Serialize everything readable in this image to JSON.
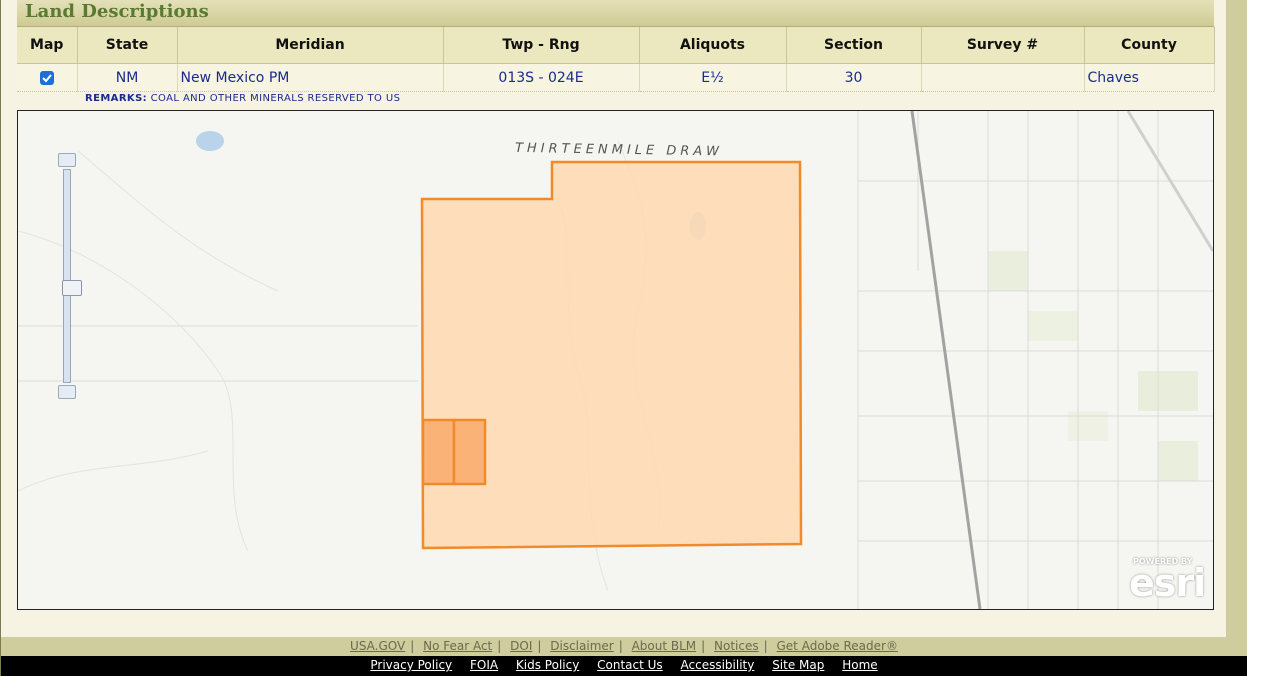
{
  "section": {
    "title": "Land Descriptions"
  },
  "table": {
    "headers": [
      "Map",
      "State",
      "Meridian",
      "Twp - Rng",
      "Aliquots",
      "Section",
      "Survey #",
      "County"
    ],
    "row": {
      "map_checked": true,
      "state": "NM",
      "meridian": "New Mexico PM",
      "twp_rng": "013S - 024E",
      "aliquots": "E½",
      "section": "30",
      "survey": "",
      "county": "Chaves"
    },
    "remarks_label": "REMARKS:",
    "remarks_text": "COAL AND OTHER MINERALS RESERVED TO US"
  },
  "map": {
    "label_feature": "THIRTEENMILE DRAW",
    "attribution_small": "POWERED BY",
    "attribution_brand": "esri",
    "parcel_fill_color": "#ffd9b0",
    "parcel_stroke_color": "#f08a2a",
    "highlight_fill_color": "#fbb276"
  },
  "footer": {
    "top_links": [
      "USA.GOV",
      "No Fear Act",
      "DOI",
      "Disclaimer",
      "About BLM",
      "Notices",
      "Get Adobe Reader®"
    ],
    "bottom_links": [
      "Privacy Policy",
      "FOIA",
      "Kids Policy",
      "Contact Us",
      "Accessibility",
      "Site Map",
      "Home"
    ]
  }
}
